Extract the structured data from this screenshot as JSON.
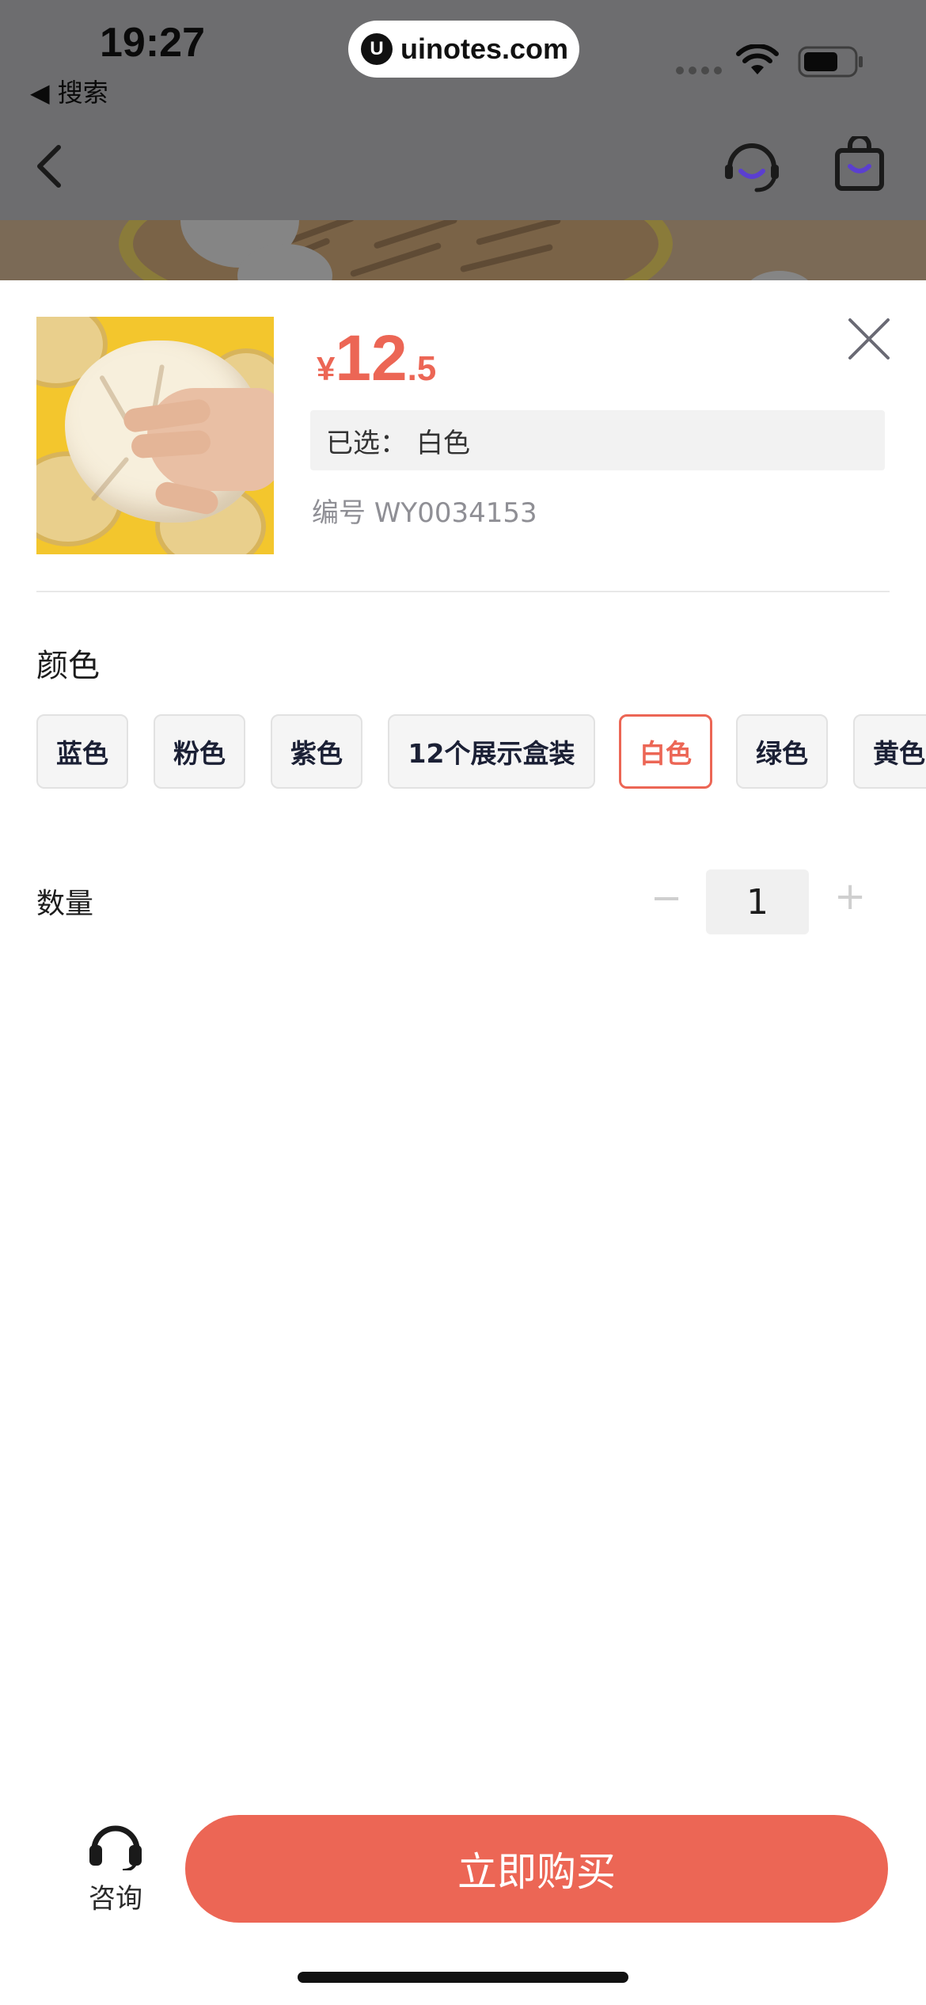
{
  "status_bar": {
    "time": "19:27",
    "back_label": "◀ 搜索",
    "url": "uinotes.com",
    "url_logo_letter": "U"
  },
  "nav": {
    "back_icon": "chevron-left-icon",
    "service_icon": "customer-service-icon",
    "bag_icon": "shopping-bag-icon"
  },
  "product": {
    "price_symbol": "¥",
    "price_int": "12",
    "price_dec": ".5",
    "selected_label": "已选：",
    "selected_value": "白色",
    "sku_label": "编号",
    "sku_value": "WY0034153"
  },
  "color": {
    "title": "颜色",
    "options": [
      {
        "label": "蓝色",
        "active": false
      },
      {
        "label": "粉色",
        "active": false
      },
      {
        "label": "紫色",
        "active": false
      },
      {
        "label": "12个展示盒装",
        "active": false
      },
      {
        "label": "白色",
        "active": true
      },
      {
        "label": "绿色",
        "active": false
      },
      {
        "label": "黄色",
        "active": false
      }
    ]
  },
  "quantity": {
    "label": "数量",
    "minus": "−",
    "value": "1",
    "plus": "+"
  },
  "bottom": {
    "consult_label": "咨询",
    "buy_label": "立即购买"
  },
  "colors": {
    "accent": "#ec6655",
    "chip_text": "#1b2035",
    "icon_purple": "#5b3fd0"
  }
}
